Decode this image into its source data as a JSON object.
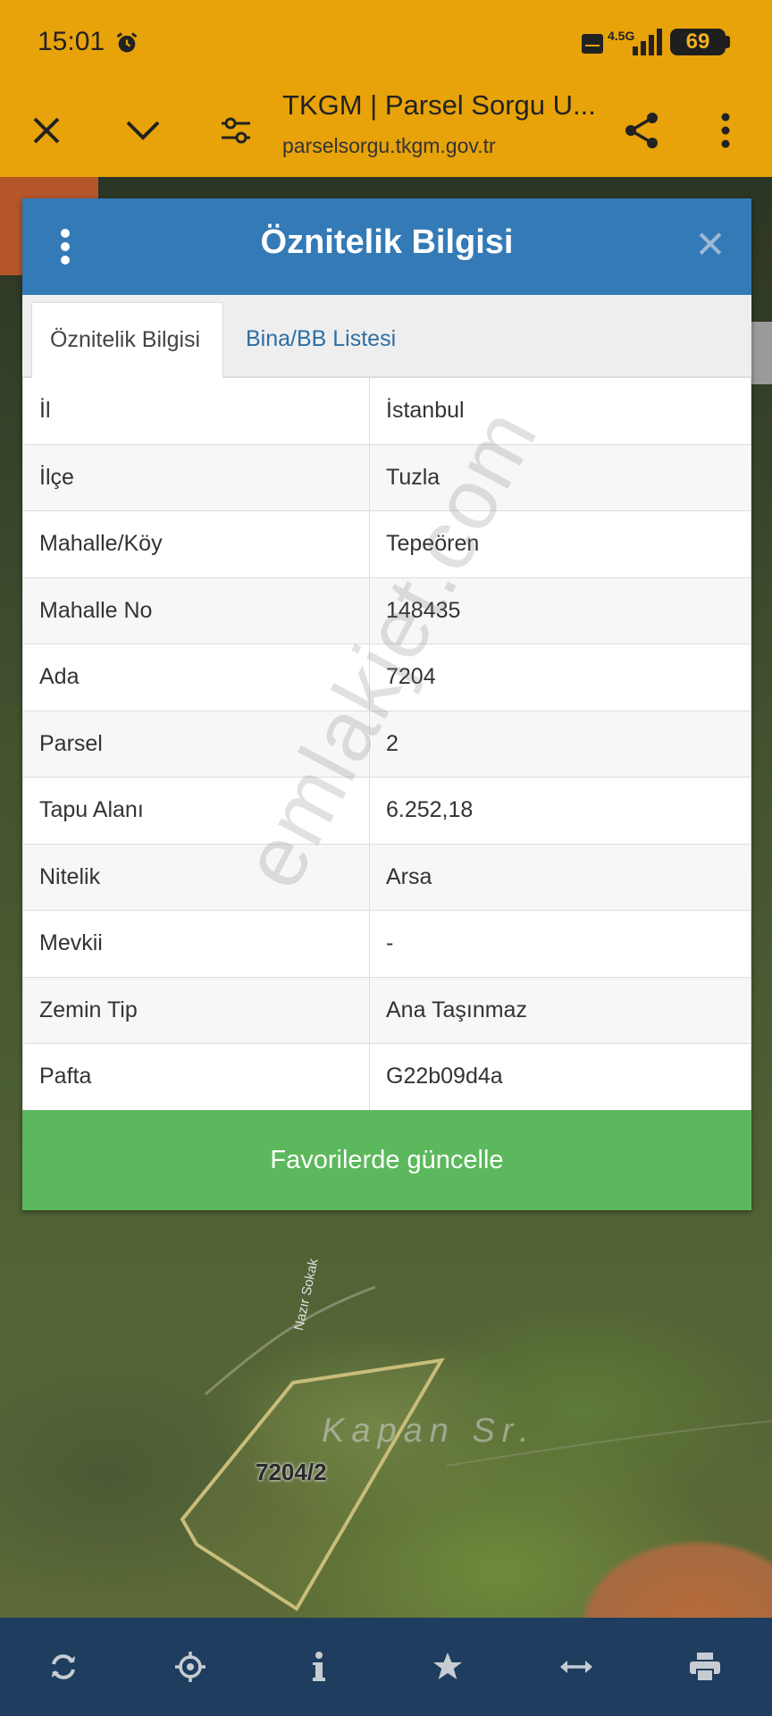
{
  "status_bar": {
    "time": "15:01",
    "network": "4.5G",
    "battery": "69"
  },
  "browser": {
    "title": "TKGM | Parsel Sorgu U...",
    "url": "parselsorgu.tkgm.gov.tr",
    "icons": [
      "close-icon",
      "chevron-down-icon",
      "tune-icon",
      "share-icon",
      "more-vert-icon"
    ]
  },
  "dialog": {
    "title": "Öznitelik Bilgisi",
    "tabs": [
      {
        "label": "Öznitelik Bilgisi",
        "active": true
      },
      {
        "label": "Bina/BB Listesi",
        "active": false
      }
    ],
    "rows": [
      {
        "key": "İl",
        "value": "İstanbul"
      },
      {
        "key": "İlçe",
        "value": "Tuzla"
      },
      {
        "key": "Mahalle/Köy",
        "value": "Tepeören"
      },
      {
        "key": "Mahalle No",
        "value": "148435"
      },
      {
        "key": "Ada",
        "value": "7204"
      },
      {
        "key": "Parsel",
        "value": "2"
      },
      {
        "key": "Tapu Alanı",
        "value": "6.252,18"
      },
      {
        "key": "Nitelik",
        "value": "Arsa"
      },
      {
        "key": "Mevkii",
        "value": "-"
      },
      {
        "key": "Zemin Tip",
        "value": "Ana Taşınmaz"
      },
      {
        "key": "Pafta",
        "value": "G22b09d4a"
      }
    ],
    "button_label": "Favorilerde güncelle"
  },
  "watermark": "emlakjet.com",
  "map": {
    "street_label": "Nazır Sokak",
    "area_label": "Kapan Sr.",
    "parcel_label": "7204/2"
  },
  "bottom_toolbar": [
    "refresh-icon",
    "locate-icon",
    "info-icon",
    "favorite-star-icon",
    "measure-icon",
    "print-icon"
  ],
  "colors": {
    "browser_bar": "#e8a30a",
    "dialog_header": "#337ab7",
    "button": "#5cb85c",
    "toolbar": "#1f3e5f"
  }
}
